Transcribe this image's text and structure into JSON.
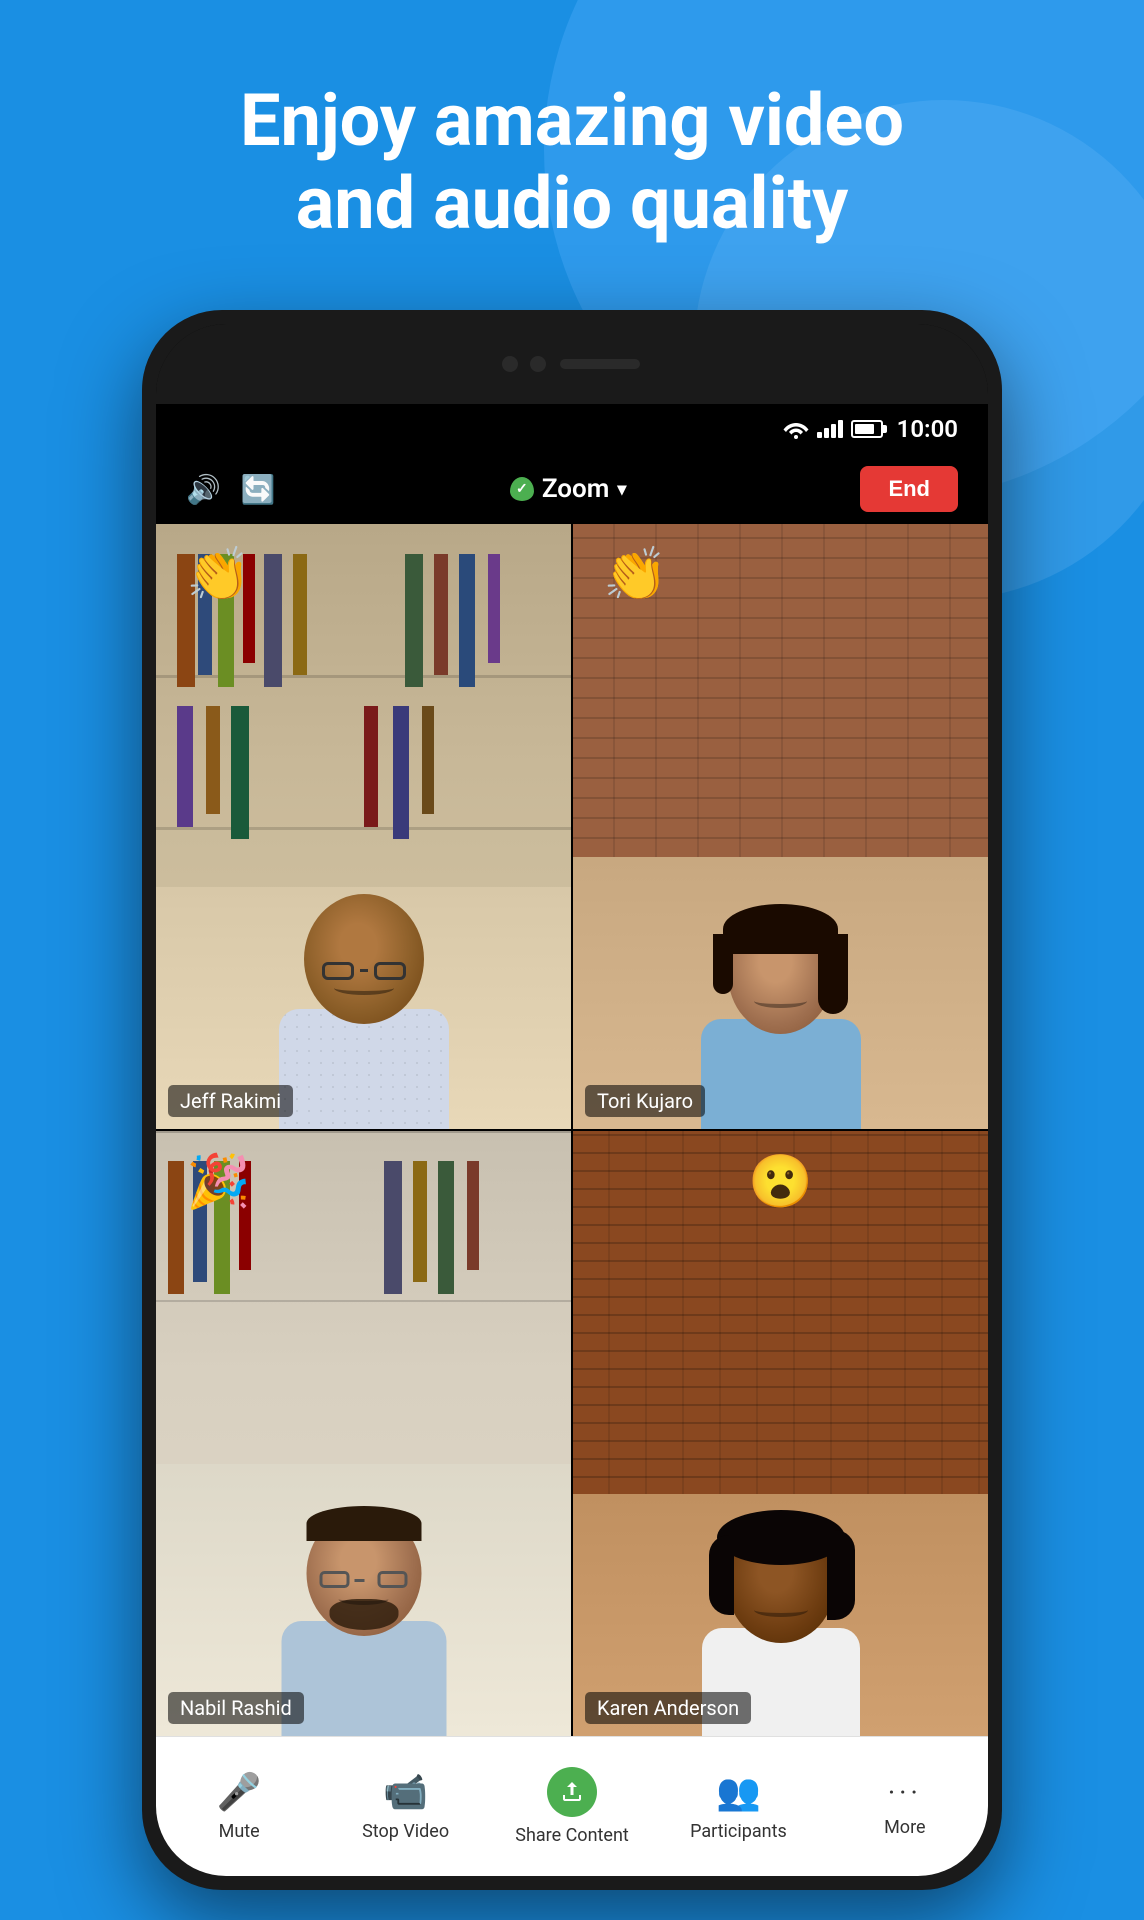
{
  "headline": {
    "line1": "Enjoy amazing video",
    "line2": "and audio quality"
  },
  "status_bar": {
    "time": "10:00"
  },
  "zoom_toolbar": {
    "brand": "Zoom",
    "end_label": "End"
  },
  "participants": [
    {
      "id": "jeff",
      "name": "Jeff Rakimi",
      "emoji": "👏",
      "emoji_position": "left",
      "active_speaker": false
    },
    {
      "id": "tori",
      "name": "Tori Kujaro",
      "emoji": "👏",
      "emoji_position": "left",
      "active_speaker": true
    },
    {
      "id": "nabil",
      "name": "Nabil Rashid",
      "emoji": "🎉",
      "emoji_position": "left",
      "active_speaker": false
    },
    {
      "id": "karen",
      "name": "Karen Anderson",
      "emoji": "😮",
      "emoji_position": "left",
      "active_speaker": false
    }
  ],
  "bottom_nav": {
    "items": [
      {
        "id": "mute",
        "label": "Mute",
        "icon": "🎤"
      },
      {
        "id": "stop-video",
        "label": "Stop Video",
        "icon": "📹"
      },
      {
        "id": "share-content",
        "label": "Share Content",
        "icon": "↑"
      },
      {
        "id": "participants",
        "label": "Participants",
        "icon": "👥"
      },
      {
        "id": "more",
        "label": "More",
        "icon": "···"
      }
    ]
  }
}
